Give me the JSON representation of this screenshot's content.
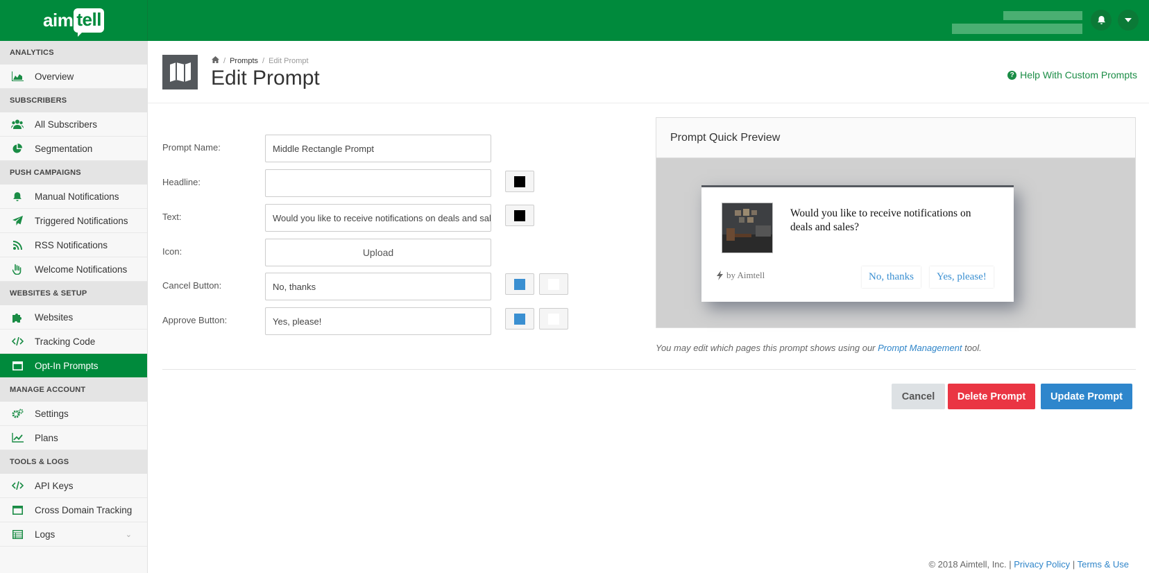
{
  "app": {
    "logo_aim": "aim",
    "logo_tell": "tell"
  },
  "sidebar": {
    "sections": [
      {
        "title": "ANALYTICS",
        "items": [
          {
            "label": "Overview",
            "icon": "area-chart-icon"
          }
        ]
      },
      {
        "title": "SUBSCRIBERS",
        "items": [
          {
            "label": "All Subscribers",
            "icon": "users-icon"
          },
          {
            "label": "Segmentation",
            "icon": "pie-chart-icon"
          }
        ]
      },
      {
        "title": "PUSH CAMPAIGNS",
        "items": [
          {
            "label": "Manual Notifications",
            "icon": "bell-icon"
          },
          {
            "label": "Triggered Notifications",
            "icon": "paper-plane-icon"
          },
          {
            "label": "RSS Notifications",
            "icon": "rss-icon"
          },
          {
            "label": "Welcome Notifications",
            "icon": "hand-wave-icon"
          }
        ]
      },
      {
        "title": "WEBSITES & SETUP",
        "items": [
          {
            "label": "Websites",
            "icon": "puzzle-icon"
          },
          {
            "label": "Tracking Code",
            "icon": "code-icon"
          },
          {
            "label": "Opt-In Prompts",
            "icon": "window-icon",
            "active": true
          }
        ]
      },
      {
        "title": "MANAGE ACCOUNT",
        "items": [
          {
            "label": "Settings",
            "icon": "gears-icon"
          },
          {
            "label": "Plans",
            "icon": "line-chart-icon"
          }
        ]
      },
      {
        "title": "TOOLS & LOGS",
        "items": [
          {
            "label": "API Keys",
            "icon": "code-icon"
          },
          {
            "label": "Cross Domain Tracking",
            "icon": "window-icon"
          },
          {
            "label": "Logs",
            "icon": "table-icon"
          }
        ]
      }
    ]
  },
  "header": {
    "breadcrumb": [
      "Prompts",
      "Edit Prompt"
    ],
    "title": "Edit Prompt",
    "help_link": "Help With Custom Prompts"
  },
  "form": {
    "prompt_name_label": "Prompt Name:",
    "prompt_name_value": "Middle Rectangle Prompt",
    "headline_label": "Headline:",
    "headline_value": "",
    "text_label": "Text:",
    "text_value": "Would you like to receive notifications on deals and sales?",
    "icon_label": "Icon:",
    "icon_upload": "Upload",
    "cancel_label": "Cancel Button:",
    "cancel_value": "No, thanks",
    "approve_label": "Approve Button:",
    "approve_value": "Yes, please!",
    "colors": {
      "headline": "#000000",
      "text": "#000000",
      "cancel_text": "#3a8fd1",
      "cancel_bg": "#ffffff",
      "approve_text": "#3a8fd1",
      "approve_bg": "#ffffff"
    }
  },
  "preview": {
    "title": "Prompt Quick Preview",
    "message": "Would you like to receive notifications on deals and sales?",
    "by": "by Aimtell",
    "no_button": "No, thanks",
    "yes_button": "Yes, please!"
  },
  "note": {
    "before": "You may edit which pages this prompt shows using our ",
    "link": "Prompt Management",
    "after": " tool."
  },
  "actions": {
    "cancel": "Cancel",
    "delete": "Delete Prompt",
    "update": "Update Prompt"
  },
  "footer": {
    "copyright": "© 2018 Aimtell, Inc. |",
    "privacy": "Privacy Policy",
    "sep": "|",
    "terms": "Terms & Use"
  },
  "colors": {
    "brand_green": "#008a3c",
    "delete_red": "#ea3543",
    "update_blue": "#2e86cc"
  }
}
